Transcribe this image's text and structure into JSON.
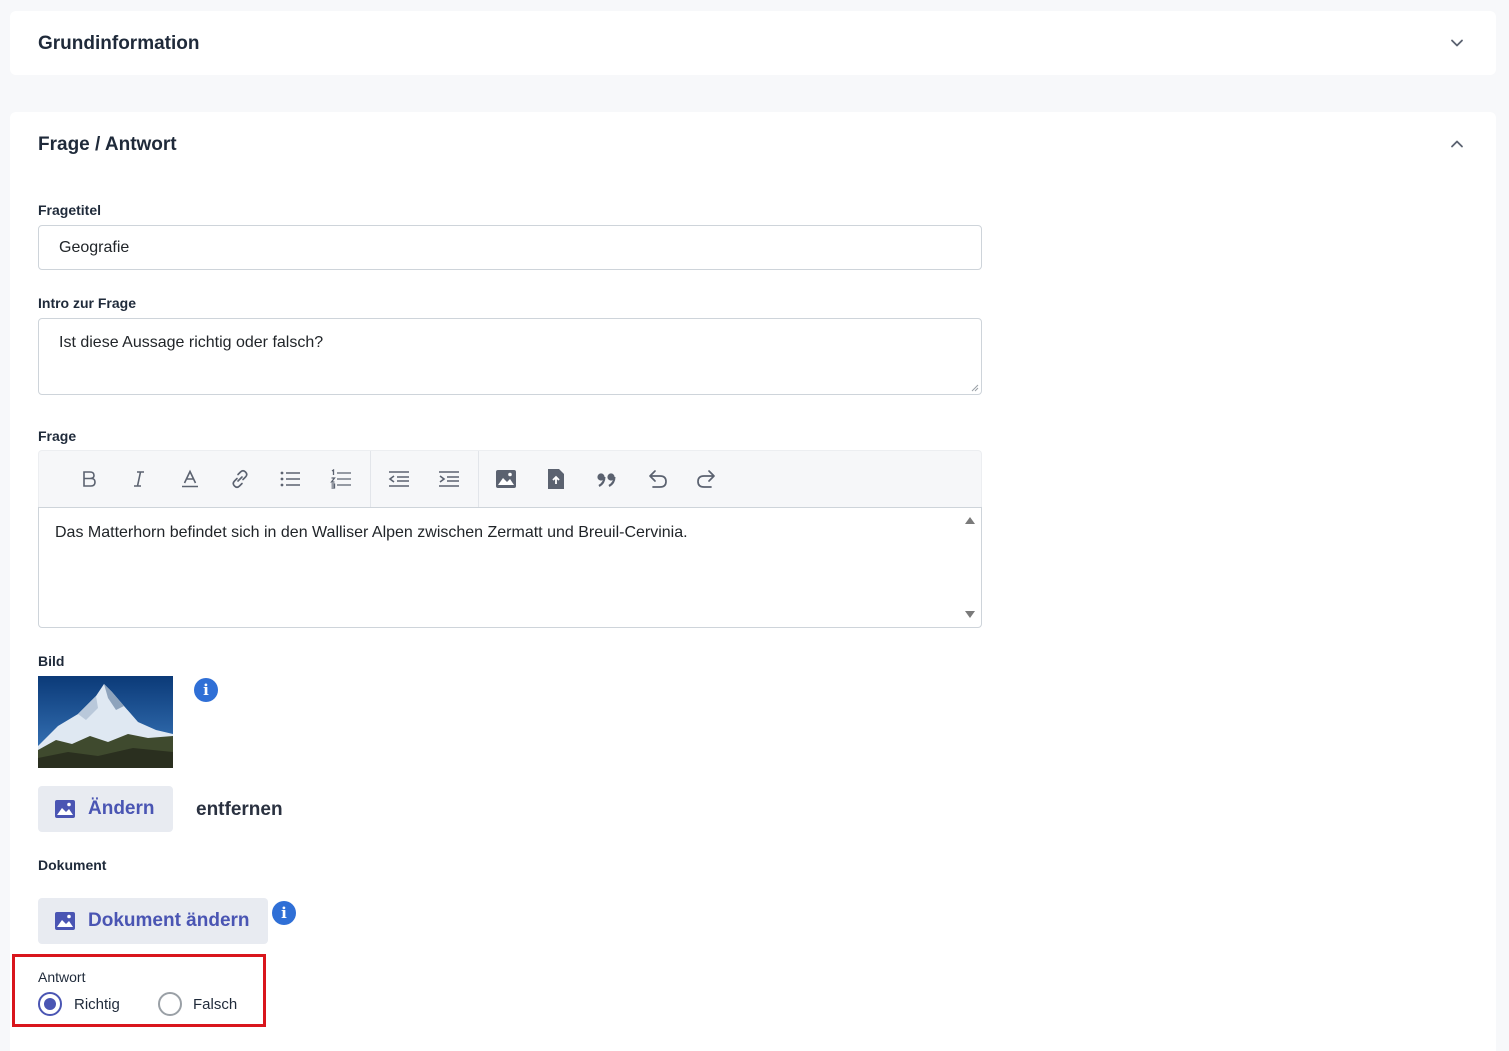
{
  "sections": {
    "basic": {
      "title": "Grundinformation",
      "icon": "chevron-down-icon"
    },
    "qa": {
      "title": "Frage / Antwort",
      "icon": "chevron-up-icon"
    }
  },
  "fields": {
    "title": {
      "label": "Fragetitel",
      "value": "Geografie"
    },
    "intro": {
      "label": "Intro zur Frage",
      "value": "Ist diese Aussage richtig oder falsch?"
    },
    "question": {
      "label": "Frage",
      "value": "Das Matterhorn befindet sich in den Walliser Alpen zwischen Zermatt und Breuil-Cervinia.",
      "toolbar": [
        "bold-icon",
        "italic-icon",
        "text-color-icon",
        "link-icon",
        "bullet-list-icon",
        "numbered-list-icon",
        "outdent-icon",
        "indent-icon",
        "image-icon",
        "upload-file-icon",
        "quote-icon",
        "undo-icon",
        "redo-icon"
      ]
    },
    "image": {
      "label": "Bild",
      "change_label": "Ändern",
      "remove_label": "entfernen"
    },
    "document": {
      "label": "Dokument",
      "change_label": "Dokument ändern"
    },
    "answer": {
      "label": "Antwort",
      "options": [
        {
          "label": "Richtig",
          "selected": true
        },
        {
          "label": "Falsch",
          "selected": false
        }
      ]
    }
  },
  "colors": {
    "accent": "#4a55b3",
    "info": "#2f6fd6",
    "highlight": "#d9161c"
  }
}
